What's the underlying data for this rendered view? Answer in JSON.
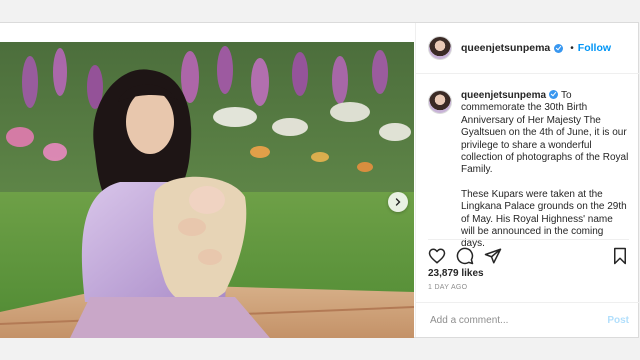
{
  "post": {
    "username": "queenjetsunpema",
    "follow_label": "Follow",
    "separator": "•",
    "caption_paragraphs": [
      "To commemorate the 30th Birth Anniversary of Her Majesty The Gyaltsuen on the 4th of June, it is our privilege to share a wonderful collection of photographs of the Royal Family.",
      "These Kupars were taken at the Lingkana Palace grounds on the 29th of May. His Royal Highness' name will be announced in the coming days."
    ],
    "likes": "23,879 likes",
    "time": "1 DAY AGO",
    "comment_placeholder": "Add a comment...",
    "post_label": "Post",
    "verified_icon": "verified-badge-icon"
  },
  "colors": {
    "accent": "#0095f6",
    "post_disabled": "#b2dffc",
    "text": "#262626",
    "muted": "#8e8e8e"
  }
}
